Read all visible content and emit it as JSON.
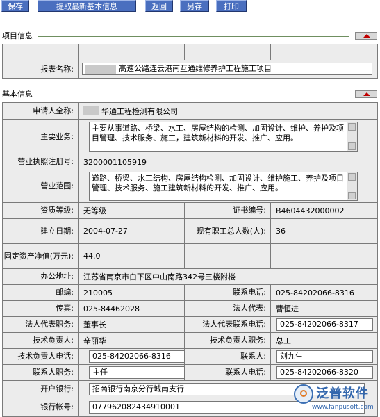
{
  "toolbar": {
    "save": "保存",
    "fetch_latest": "提取最新基本信息",
    "back": "返回",
    "save_as": "另存",
    "print": "打印"
  },
  "project_section": {
    "title": "项目信息",
    "report_name_label": "报表名称:",
    "report_name_value": "高速公路连云港南互通维修养护工程施工项目"
  },
  "basic_section": {
    "title": "基本信息",
    "applicant_label": "申请人全称:",
    "applicant_value": "华通工程检测有限公司",
    "main_business_label": "主要业务:",
    "main_business_value": "主要从事道路、桥梁、水工、房屋结构的检测、加固设计、维护、养护及项目管理、技术服务、施工，建筑新材料的开发、推广、应用。",
    "license_label": "营业执照注册号:",
    "license_value": "3200001105919",
    "scope_label": "营业范围:",
    "scope_value": "道路、桥梁、水工结构、房屋结构检测、加固设计、维护施工、养护及项目管理、技术服务、施工建筑新材料的开发、推广、应用。",
    "qualification_label": "资质等级:",
    "qualification_value": "无等级",
    "cert_no_label": "证书编号:",
    "cert_no_value": "B4604432000002",
    "established_label": "建立日期:",
    "established_value": "2004-07-27",
    "staff_label": "现有职工总人数(人):",
    "staff_value": "36",
    "assets_label": "固定资产净值(万元):",
    "assets_value": "44.0",
    "address_label": "办公地址:",
    "address_value": "江苏省南京市白下区中山南路342号三楼附楼",
    "postcode_label": "邮编:",
    "postcode_value": "210005",
    "phone_label": "联系电话:",
    "phone_value": "025-84202066-8316",
    "fax_label": "传真:",
    "fax_value": "025-84462028",
    "legal_rep_label": "法人代表:",
    "legal_rep_value": "曹恒进",
    "legal_title_label": "法人代表职务:",
    "legal_title_value": "董事长",
    "legal_phone_label": "法人代表联系电话:",
    "legal_phone_value": "025-84202066-8317",
    "tech_lead_label": "技术负责人:",
    "tech_lead_value": "辛丽华",
    "tech_title_label": "技术负责人职务:",
    "tech_title_value": "总工",
    "tech_phone_label": "技术负责人电话:",
    "tech_phone_value": "025-84202066-8316",
    "contact_label": "联系人:",
    "contact_value": "刘九生",
    "contact_title_label": "联系人职务:",
    "contact_title_value": "主任",
    "contact_phone_label": "联系人电话:",
    "contact_phone_value": "025-84202066-8320",
    "bank_label": "开户银行:",
    "bank_value": "招商银行南京分行城南支行",
    "account_label": "银行帐号:",
    "account_value": "077962082434910001"
  },
  "watermark": {
    "brand": "泛普软件",
    "url": "www.fanpusoft.com"
  }
}
